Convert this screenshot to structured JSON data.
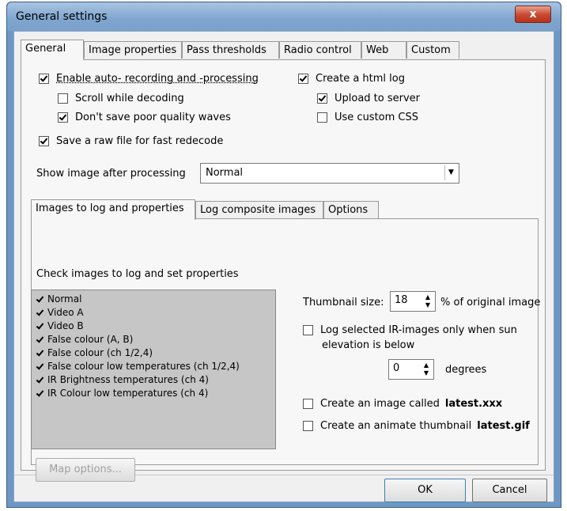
{
  "window": {
    "title": "General settings",
    "close_glyph": "x"
  },
  "main_tabs": [
    "General",
    "Image properties",
    "Pass thresholds",
    "Radio control",
    "Web",
    "Custom"
  ],
  "general": {
    "enable_auto": {
      "label": "Enable auto- recording and -processing",
      "checked": true
    },
    "scroll_decoding": {
      "label": "Scroll while decoding",
      "checked": false
    },
    "dont_save_poor": {
      "label": "Don't save poor quality waves",
      "checked": true
    },
    "save_raw": {
      "label": "Save a raw file for fast redecode",
      "checked": true
    },
    "create_html_log": {
      "label": "Create a html log",
      "checked": true
    },
    "upload_server": {
      "label": "Upload to server",
      "checked": true
    },
    "use_custom_css": {
      "label": "Use custom CSS",
      "checked": false
    },
    "show_image_label": "Show image after processing",
    "show_image_value": "Normal"
  },
  "sub_tabs": [
    "Images to log and properties",
    "Log composite images",
    "Options"
  ],
  "images": {
    "heading": "Check images to log and set properties",
    "items": [
      "Normal",
      "Video A",
      "Video B",
      "False colour (A, B)",
      "False colour (ch 1/2,4)",
      "False colour low temperatures (ch 1/2,4)",
      "IR Brightness temperatures (ch 4)",
      "IR Colour low temperatures (ch 4)"
    ],
    "thumbnail_label": "Thumbnail size:",
    "thumbnail_value": "18",
    "thumbnail_suffix": "% of original image",
    "log_ir_label_1": "Log selected IR-images only when sun",
    "log_ir_label_2": "elevation is below",
    "degrees_value": "0",
    "degrees_label": "degrees",
    "latest_label": "Create an image called",
    "latest_file": "latest.xxx",
    "anim_label": "Create an animate thumbnail",
    "anim_file": "latest.gif",
    "map_options": "Map options..."
  },
  "buttons": {
    "ok": "OK",
    "cancel": "Cancel"
  }
}
